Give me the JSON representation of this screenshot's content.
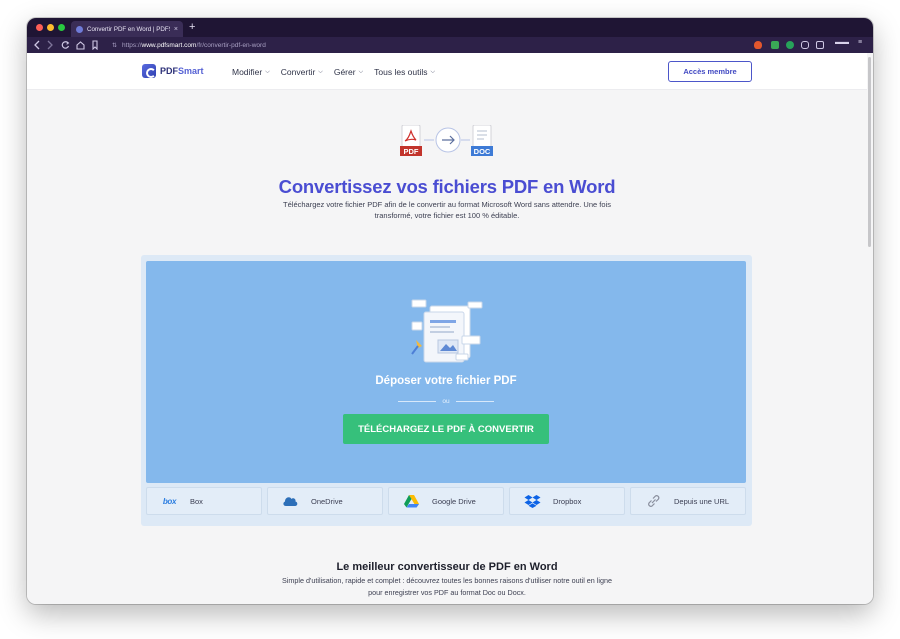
{
  "browser": {
    "tab_title": "Convertir PDF en Word | PDFSmart",
    "tab_close": "×",
    "new_tab": "+",
    "url_prefix": "https://",
    "url_host": "www.pdfsmart.com",
    "url_path": "/fr/convertir-pdf-en-word",
    "icons": [
      "back-icon",
      "forward-icon",
      "reload-icon",
      "home-icon",
      "bookmark-icon",
      "site-settings-icon",
      "shield-icon",
      "extension-icons",
      "menu-icon"
    ]
  },
  "header": {
    "logo_pdf": "PDF",
    "logo_smart": "Smart",
    "menu": [
      {
        "label": "Modifier",
        "icon": "chevron-down-icon"
      },
      {
        "label": "Convertir",
        "icon": "chevron-down-icon"
      },
      {
        "label": "Gérer",
        "icon": "chevron-down-icon"
      },
      {
        "label": "Tous les outils",
        "icon": "chevron-down-icon"
      }
    ],
    "member_button": "Accès membre"
  },
  "hero": {
    "pdf_badge": "PDF",
    "doc_badge": "DOC",
    "title": "Convertissez vos fichiers PDF en Word",
    "subtitle": "Téléchargez votre fichier PDF afin de le convertir au format Microsoft Word sans attendre. Une fois transformé, votre fichier est 100 % éditable."
  },
  "upload": {
    "drop_label": "Déposer votre fichier PDF",
    "or_text": "ou",
    "button_label": "TÉLÉCHARGEZ LE PDF À CONVERTIR",
    "accent_color": "#84b8ec",
    "button_color": "#36c07b",
    "sources": [
      {
        "label": "Box",
        "icon": "box-logo-icon",
        "logo_text": "box"
      },
      {
        "label": "OneDrive",
        "icon": "onedrive-icon"
      },
      {
        "label": "Google Drive",
        "icon": "google-drive-icon"
      },
      {
        "label": "Dropbox",
        "icon": "dropbox-icon"
      },
      {
        "label": "Depuis une URL",
        "icon": "link-icon"
      }
    ]
  },
  "features": {
    "title": "Le meilleur convertisseur de PDF en Word",
    "subtitle": "Simple d'utilisation, rapide et complet : découvrez toutes les bonnes raisons d'utiliser notre outil en ligne pour enregistrer vos PDF au format Doc ou Docx."
  }
}
